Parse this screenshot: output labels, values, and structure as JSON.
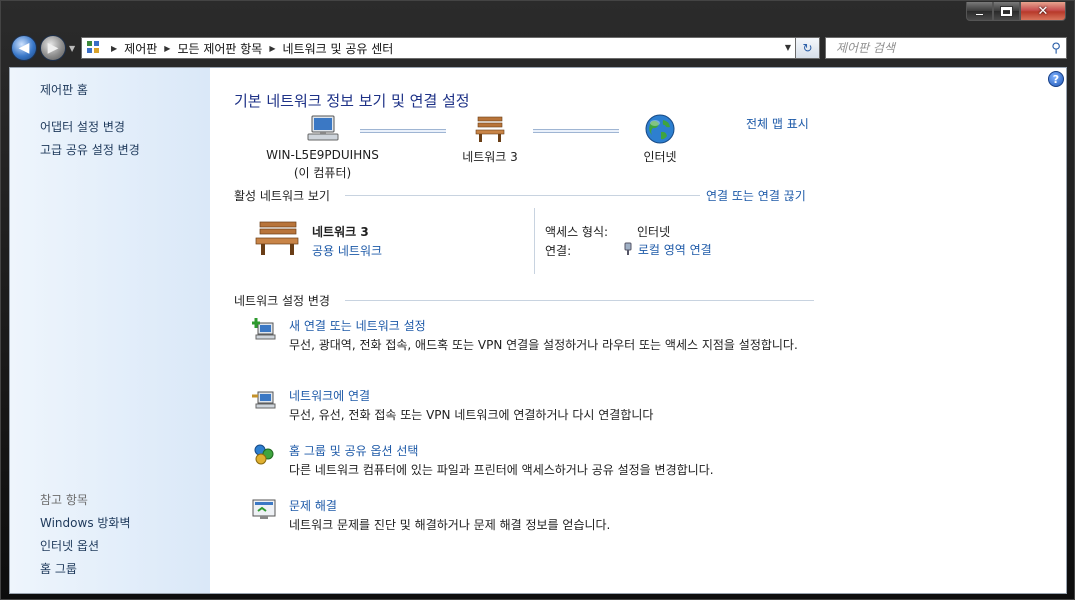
{
  "window": {
    "caption_buttons": {
      "minimize_icon": "minimize-icon",
      "maximize_icon": "maximize-icon",
      "close_glyph": "✕"
    }
  },
  "nav": {
    "back_glyph": "◀",
    "forward_glyph": "▶",
    "breadcrumbs": [
      "제어판",
      "모든 제어판 항목",
      "네트워크 및 공유 센터"
    ],
    "separator": "▶",
    "dropdown_glyph": "▼",
    "refresh_glyph": "↻",
    "search_placeholder": "제어판 검색",
    "search_glyph": "⚲"
  },
  "sidebar": {
    "items": [
      {
        "label": "제어판 홈"
      },
      {
        "label": "어댑터 설정 변경"
      },
      {
        "label": "고급 공유 설정 변경"
      }
    ],
    "see_also_label": "참고 항목",
    "see_also": [
      {
        "label": "Windows 방화벽"
      },
      {
        "label": "인터넷 옵션"
      },
      {
        "label": "홈 그룹"
      }
    ]
  },
  "help_glyph": "?",
  "main": {
    "title": "기본 네트워크 정보 보기 및 연결 설정",
    "full_map_link": "전체 맵 표시",
    "map": {
      "computer_name": "WIN-L5E9PDUIHNS",
      "computer_sub": "(이 컴퓨터)",
      "network_name": "네트워크  3",
      "internet": "인터넷"
    },
    "active_networks": {
      "heading": "활성 네트워크 보기",
      "link": "연결 또는 연결 끊기",
      "name": "네트워크  3",
      "type": "공용 네트워크",
      "access_type_label": "액세스 형식:",
      "access_type_value": "인터넷",
      "connections_label": "연결:",
      "connections_value": "로컬 영역 연결"
    },
    "change_settings": {
      "heading": "네트워크 설정 변경",
      "tasks": [
        {
          "title": "새 연결 또는 네트워크 설정",
          "desc": "무선, 광대역, 전화 접속, 애드혹 또는 VPN 연결을 설정하거나 라우터 또는 액세스 지점을 설정합니다."
        },
        {
          "title": "네트워크에 연결",
          "desc": "무선, 유선, 전화 접속 또는 VPN 네트워크에 연결하거나 다시 연결합니다"
        },
        {
          "title": "홈 그룹 및 공유 옵션 선택",
          "desc": "다른 네트워크 컴퓨터에 있는 파일과 프린터에 액세스하거나 공유 설정을 변경합니다."
        },
        {
          "title": "문제 해결",
          "desc": "네트워크 문제를 진단 및 해결하거나 문제 해결 정보를 얻습니다."
        }
      ]
    }
  }
}
